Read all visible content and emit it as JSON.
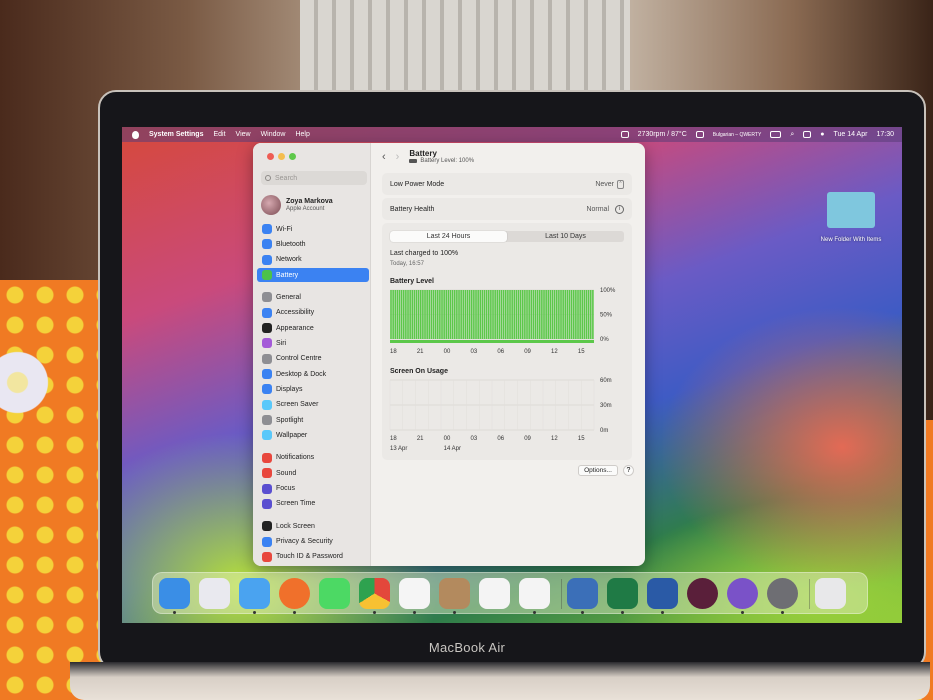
{
  "menubar": {
    "app": "System Settings",
    "items": [
      "Edit",
      "View",
      "Window",
      "Help"
    ],
    "status": {
      "cpu": "2730rpm / 87°C",
      "input": "Bulgarian – QWERTY",
      "date": "Tue 14 Apr",
      "time": "17:30"
    }
  },
  "desktop": {
    "folder_label": "New Folder With Items"
  },
  "window": {
    "account": {
      "name": "Zoya Markova",
      "subtitle": "Apple Account"
    },
    "search_placeholder": "Search",
    "sidebar": [
      {
        "label": "Wi‑Fi",
        "icon": "wifi-icon",
        "color": "#3b82f2"
      },
      {
        "label": "Bluetooth",
        "icon": "bluetooth-icon",
        "color": "#3b82f2"
      },
      {
        "label": "Network",
        "icon": "network-icon",
        "color": "#3b82f2"
      },
      {
        "label": "Battery",
        "icon": "battery-icon",
        "color": "#4cc24a",
        "selected": true
      },
      {
        "label": "General",
        "icon": "gear-icon",
        "color": "#8e8e93"
      },
      {
        "label": "Accessibility",
        "icon": "accessibility-icon",
        "color": "#3b82f2"
      },
      {
        "label": "Appearance",
        "icon": "appearance-icon",
        "color": "#222222"
      },
      {
        "label": "Siri",
        "icon": "siri-icon",
        "color": "#a45ad8"
      },
      {
        "label": "Control Centre",
        "icon": "control-centre-icon",
        "color": "#8e8e93"
      },
      {
        "label": "Desktop & Dock",
        "icon": "dock-icon",
        "color": "#3b82f2"
      },
      {
        "label": "Displays",
        "icon": "displays-icon",
        "color": "#3b82f2"
      },
      {
        "label": "Screen Saver",
        "icon": "screen-saver-icon",
        "color": "#5ac8fa"
      },
      {
        "label": "Spotlight",
        "icon": "spotlight-icon",
        "color": "#8e8e93"
      },
      {
        "label": "Wallpaper",
        "icon": "wallpaper-icon",
        "color": "#5ac8fa"
      },
      {
        "label": "Notifications",
        "icon": "notifications-icon",
        "color": "#e8473d"
      },
      {
        "label": "Sound",
        "icon": "sound-icon",
        "color": "#e8473d"
      },
      {
        "label": "Focus",
        "icon": "focus-icon",
        "color": "#5a4fd0"
      },
      {
        "label": "Screen Time",
        "icon": "screen-time-icon",
        "color": "#5a4fd0"
      },
      {
        "label": "Lock Screen",
        "icon": "lock-icon",
        "color": "#222222"
      },
      {
        "label": "Privacy & Security",
        "icon": "privacy-icon",
        "color": "#3b82f2"
      },
      {
        "label": "Touch ID & Password",
        "icon": "touch-id-icon",
        "color": "#e8473d"
      }
    ],
    "header": {
      "title": "Battery",
      "subtitle": "Battery Level: 100%"
    },
    "low_power": {
      "label": "Low Power Mode",
      "value": "Never"
    },
    "health": {
      "label": "Battery Health",
      "value": "Normal"
    },
    "tabs": [
      "Last 24 Hours",
      "Last 10 Days"
    ],
    "charged": {
      "title": "Last charged to 100%",
      "time": "Today, 16:57"
    },
    "battery_chart_title": "Battery Level",
    "usage_chart_title": "Screen On Usage",
    "options_label": "Options...",
    "help_label": "?"
  },
  "chart_data": [
    {
      "type": "bar",
      "title": "Battery Level",
      "x_ticks": [
        "18",
        "21",
        "00",
        "03",
        "06",
        "09",
        "12",
        "15"
      ],
      "y_ticks": [
        "100%",
        "50%",
        "0%"
      ],
      "ylim": [
        0,
        100
      ],
      "values": [
        100,
        100,
        100,
        100,
        100,
        100,
        100,
        100,
        100,
        100,
        100,
        100,
        100,
        100,
        100,
        100,
        100,
        100,
        100,
        100,
        100,
        100,
        100,
        100,
        100,
        100,
        100,
        100,
        100,
        100,
        100,
        100,
        100,
        100,
        100,
        100,
        100,
        100,
        100,
        100,
        100,
        100,
        100,
        100,
        100,
        100,
        100,
        100,
        100,
        100,
        100,
        100,
        100,
        100,
        100,
        100,
        100,
        100,
        100,
        100,
        100,
        100,
        100,
        100,
        100,
        100,
        100,
        100,
        100,
        100,
        100,
        100,
        100,
        100,
        100,
        100,
        100,
        100,
        100,
        100,
        100,
        100,
        100,
        100,
        100,
        100,
        100,
        100,
        100,
        100,
        100,
        100,
        100,
        100,
        100,
        100
      ],
      "color": "#5cc84a"
    },
    {
      "type": "bar",
      "title": "Screen On Usage",
      "x_ticks": [
        "18",
        "21",
        "00",
        "03",
        "06",
        "09",
        "12",
        "15"
      ],
      "date_labels": [
        "13 Apr",
        "14 Apr"
      ],
      "y_ticks": [
        "60m",
        "30m",
        "0m"
      ],
      "ylim": [
        0,
        60
      ],
      "values": []
    }
  ],
  "dock": [
    {
      "name": "finder-icon",
      "color": "#3a8ee6"
    },
    {
      "name": "launchpad-icon",
      "color": "#e9e9ef"
    },
    {
      "name": "mail-icon",
      "color": "#4aa3f0"
    },
    {
      "name": "firefox-icon",
      "color": "#f0702b"
    },
    {
      "name": "messages-icon",
      "color": "#4cd964"
    },
    {
      "name": "chrome-icon",
      "color": "#f2f2f2"
    },
    {
      "name": "photos-icon",
      "color": "#f5f5f5"
    },
    {
      "name": "contacts-icon",
      "color": "#b38a5e"
    },
    {
      "name": "vectorworks-icon",
      "color": "#f4f4f4"
    },
    {
      "name": "freeform-icon",
      "color": "#f4f4f4"
    },
    {
      "name": "system-preferences-icon",
      "color": "#3b6fb8"
    },
    {
      "name": "excel-icon",
      "color": "#1f7a45"
    },
    {
      "name": "word-icon",
      "color": "#2a5aa6"
    },
    {
      "name": "media-app-icon",
      "color": "#5a1f3a"
    },
    {
      "name": "viber-icon",
      "color": "#7a52c8"
    },
    {
      "name": "system-settings-icon",
      "color": "#6e6e73"
    },
    {
      "name": "trash-icon",
      "color": "#e8e8ea"
    }
  ]
}
